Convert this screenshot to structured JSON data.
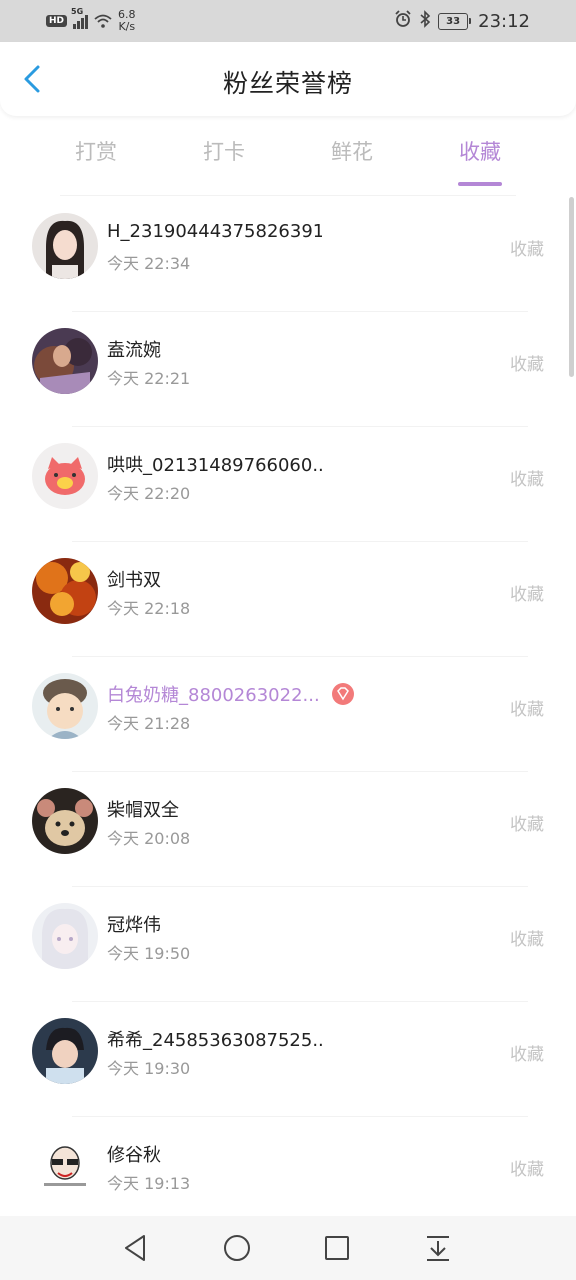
{
  "status_bar": {
    "hd": "HD",
    "network": "5G",
    "speed_value": "6.8",
    "speed_unit": "K/s",
    "battery": "33",
    "time": "23:12"
  },
  "header": {
    "title": "粉丝荣誉榜"
  },
  "tabs": [
    {
      "label": "打赏"
    },
    {
      "label": "打卡"
    },
    {
      "label": "鲜花"
    },
    {
      "label": "收藏"
    }
  ],
  "active_tab": "收藏",
  "accent_color": "#b487d6",
  "fans": [
    {
      "name": "H_231904443758263916",
      "time": "今天 22:34",
      "action": "收藏"
    },
    {
      "name": "盍流婉",
      "time": "今天 22:21",
      "action": "收藏"
    },
    {
      "name": "哄哄_02131489766060...",
      "time": "今天 22:20",
      "action": "收藏"
    },
    {
      "name": "剑书双",
      "time": "今天 22:18",
      "action": "收藏"
    },
    {
      "name": "白兔奶糖_8800263022...",
      "time": "今天 21:28",
      "action": "收藏"
    },
    {
      "name": "柴帽双全",
      "time": "今天 20:08",
      "action": "收藏"
    },
    {
      "name": "冠烨伟",
      "time": "今天 19:50",
      "action": "收藏"
    },
    {
      "name": "希希_24585363087525...",
      "time": "今天 19:30",
      "action": "收藏"
    },
    {
      "name": "修谷秋",
      "time": "今天 19:13",
      "action": "收藏"
    }
  ],
  "nav_icons": [
    "back-triangle-icon",
    "home-circle-icon",
    "recents-square-icon",
    "notification-pulldown-icon"
  ]
}
